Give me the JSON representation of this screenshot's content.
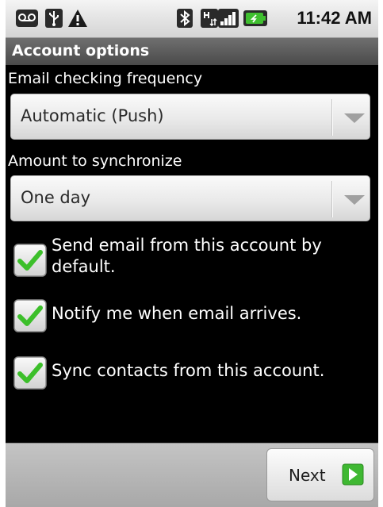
{
  "status_bar": {
    "icons": [
      "voicemail-icon",
      "usb-icon",
      "warning-icon",
      "bluetooth-icon",
      "data-icon",
      "signal-icon",
      "battery-icon"
    ],
    "time": "11:42 AM"
  },
  "title_bar": {
    "title": "Account options"
  },
  "frequency": {
    "label": "Email checking frequency",
    "value": "Automatic (Push)"
  },
  "amount": {
    "label": "Amount to synchronize",
    "value": "One day"
  },
  "options": [
    {
      "label": "Send email from this account by default.",
      "checked": true
    },
    {
      "label": "Notify me when email arrives.",
      "checked": true
    },
    {
      "label": "Sync contacts from this account.",
      "checked": true
    }
  ],
  "footer": {
    "next_label": "Next"
  },
  "colors": {
    "check_green": "#3cbf2a",
    "arrow_green": "#3fb832",
    "background": "#000000"
  }
}
